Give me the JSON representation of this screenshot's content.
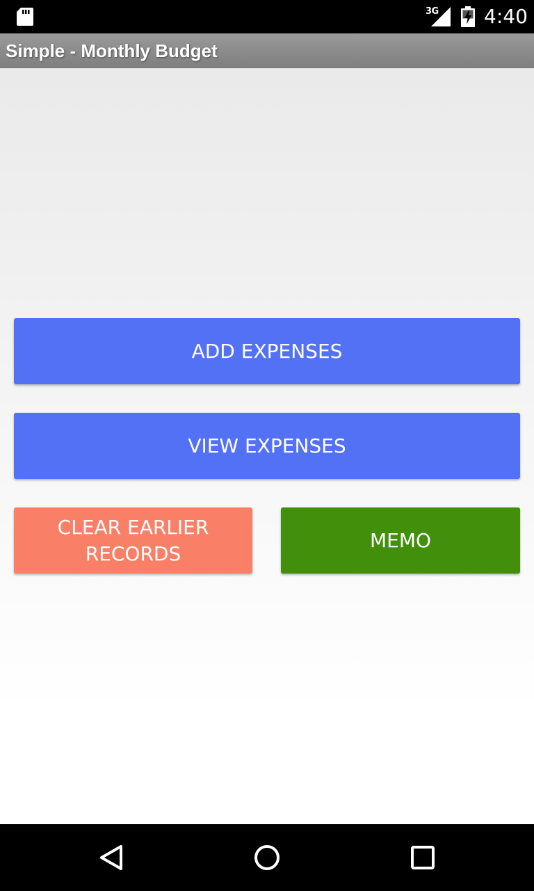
{
  "status_bar": {
    "network": "3G",
    "time": "4:40",
    "icons": [
      "sd-card-icon",
      "cell-signal-icon",
      "battery-charging-icon"
    ]
  },
  "action_bar": {
    "title": "Simple - Monthly Budget"
  },
  "buttons": {
    "add_expenses": "ADD EXPENSES",
    "view_expenses": "VIEW EXPENSES",
    "clear_records": "CLEAR EARLIER RECORDS",
    "memo": "MEMO"
  },
  "colors": {
    "primary_button": "#5271f4",
    "clear_button": "#f98066",
    "memo_button": "#418f0a"
  },
  "nav_bar": {
    "icons": [
      "back-icon",
      "home-icon",
      "recents-icon"
    ]
  }
}
